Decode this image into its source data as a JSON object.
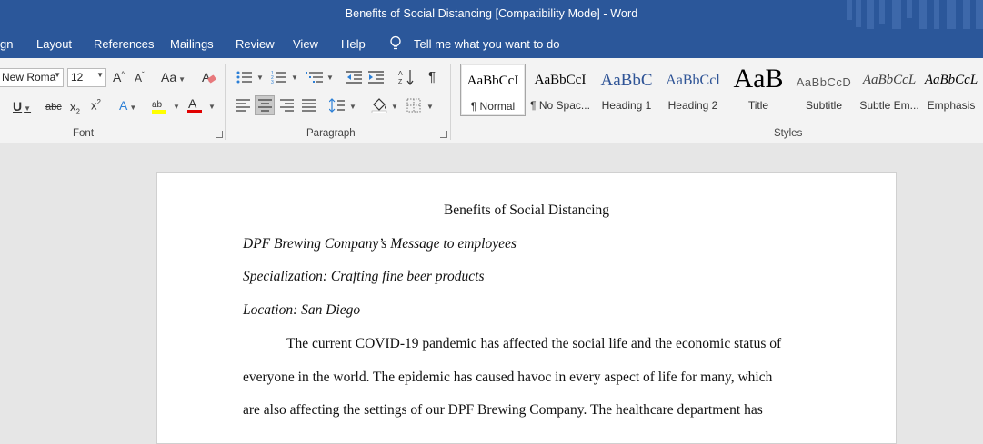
{
  "app": {
    "title": "Benefits of Social Distancing [Compatibility Mode]  -  Word"
  },
  "menu": {
    "items": [
      "gn",
      "Layout",
      "References",
      "Mailings",
      "Review",
      "View",
      "Help"
    ],
    "tell_me": "Tell me what you want to do"
  },
  "ribbon": {
    "font": {
      "name": "New Roma",
      "size": "12",
      "group_label": "Font"
    },
    "paragraph": {
      "group_label": "Paragraph"
    },
    "styles": {
      "group_label": "Styles",
      "items": [
        {
          "preview": "AaBbCcI",
          "name": "¶ Normal"
        },
        {
          "preview": "AaBbCcI",
          "name": "¶ No Spac..."
        },
        {
          "preview": "AaBbC",
          "name": "Heading 1"
        },
        {
          "preview": "AaBbCcl",
          "name": "Heading 2"
        },
        {
          "preview": "AaB",
          "name": "Title"
        },
        {
          "preview": "AaBbCcD",
          "name": "Subtitle"
        },
        {
          "preview": "AaBbCcL",
          "name": "Subtle Em..."
        },
        {
          "preview": "AaBbCcL",
          "name": "Emphasis"
        }
      ]
    }
  },
  "document": {
    "title": "Benefits of Social Distancing",
    "lines": [
      "DPF Brewing Company’s Message to employees",
      "Specialization: Crafting fine beer products",
      "Location: San Diego"
    ],
    "body": [
      "The current COVID-19 pandemic has affected the social life and the economic status of",
      "everyone in the world. The epidemic has caused havoc in every aspect of life for many, which",
      "are also affecting the settings of our DPF Brewing Company. The healthcare department has"
    ]
  },
  "colors": {
    "title_bar": "#2b579a",
    "ribbon": "#f3f3f3",
    "canvas": "#e6e6e6",
    "heading_blue": "#2f5496"
  }
}
